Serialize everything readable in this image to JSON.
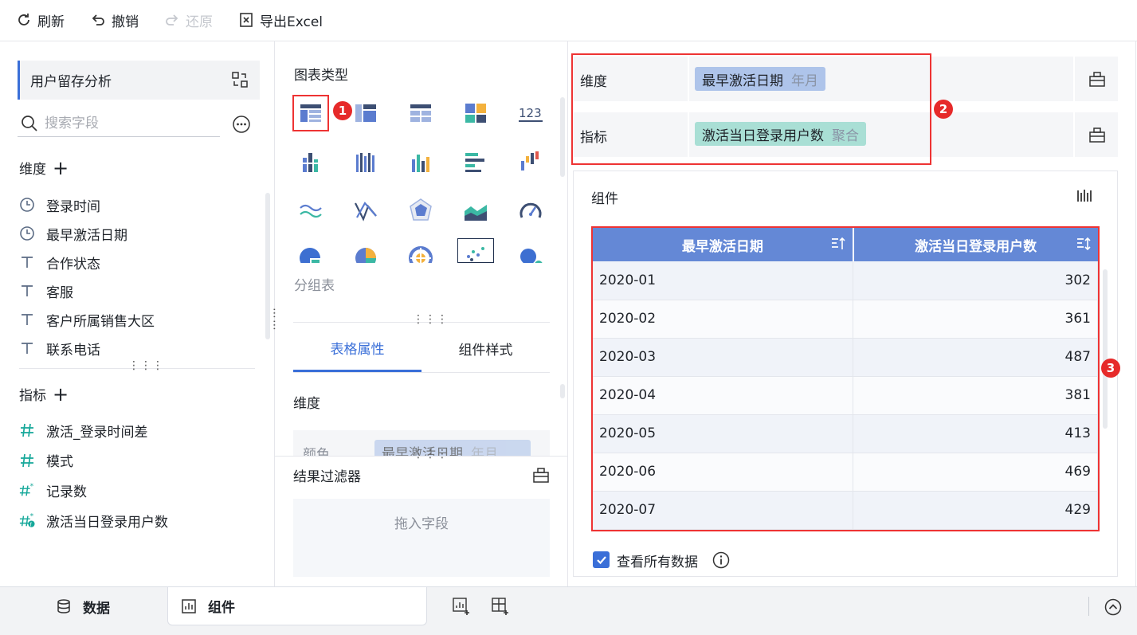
{
  "toolbar": {
    "refresh": "刷新",
    "undo": "撤销",
    "redo": "还原",
    "export": "导出Excel"
  },
  "left": {
    "dataset": "用户留存分析",
    "search_placeholder": "搜索字段",
    "dimension_title": "维度",
    "dimensions": [
      {
        "icon": "clock-icon",
        "label": "登录时间"
      },
      {
        "icon": "clock-icon",
        "label": "最早激活日期"
      },
      {
        "icon": "text-type-icon",
        "label": "合作状态"
      },
      {
        "icon": "text-type-icon",
        "label": "客服"
      },
      {
        "icon": "text-type-icon",
        "label": "客户所属销售大区"
      },
      {
        "icon": "text-type-icon",
        "label": "联系电话"
      }
    ],
    "measure_title": "指标",
    "measures": [
      {
        "icon": "hash-icon",
        "label": "激活_登录时间差"
      },
      {
        "icon": "hash-icon",
        "label": "模式"
      },
      {
        "icon": "hash-star-icon",
        "label": "记录数"
      },
      {
        "icon": "hash-formula-icon",
        "label": "激活当日登录用户数"
      }
    ]
  },
  "middle": {
    "chart_type_label": "图表类型",
    "selected_chart_name": "分组表",
    "tabs": [
      "表格属性",
      "组件样式"
    ],
    "dimension_label": "维度",
    "color_label": "颜色",
    "color_pill": {
      "field": "最早激活日期",
      "sub": "年月"
    },
    "filter_title": "结果过滤器",
    "filter_drop": "拖入字段"
  },
  "badges": [
    "1",
    "2",
    "3"
  ],
  "config": {
    "dimension_label": "维度",
    "dimension_pill": {
      "field": "最早激活日期",
      "sub": "年月"
    },
    "measure_label": "指标",
    "measure_pill": {
      "field": "激活当日登录用户数",
      "sub": "聚合"
    }
  },
  "component": {
    "title": "组件",
    "columns": [
      "最早激活日期",
      "激活当日登录用户数"
    ],
    "rows": [
      [
        "2020-01",
        "302"
      ],
      [
        "2020-02",
        "361"
      ],
      [
        "2020-03",
        "487"
      ],
      [
        "2020-04",
        "381"
      ],
      [
        "2020-05",
        "413"
      ],
      [
        "2020-06",
        "469"
      ],
      [
        "2020-07",
        "429"
      ]
    ],
    "view_all": "查看所有数据"
  },
  "bottom": {
    "data_tab": "数据",
    "component_tab": "组件"
  },
  "colors": {
    "accent": "#3a6fd8",
    "header": "#6488d6",
    "dim_pill": "#aec4ea",
    "measure_pill": "#a9dfd5",
    "highlight": "#e33333"
  }
}
